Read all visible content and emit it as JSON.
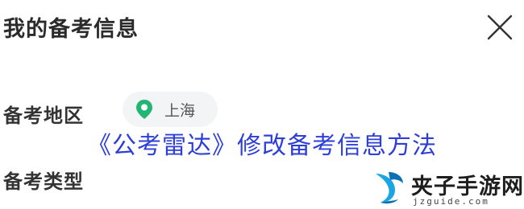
{
  "header": {
    "title": "我的备考信息"
  },
  "icons": {
    "close": "close-icon",
    "pin": "location-pin-icon"
  },
  "form": {
    "region_label": "备考地区",
    "region_value": "上海",
    "type_label": "备考类型"
  },
  "overlay": {
    "title": "《公考雷达》修改备考信息方法"
  },
  "watermark": {
    "name": "夹子手游网",
    "url": "jzguide.com"
  },
  "colors": {
    "accent_green": "#22b573",
    "overlay_blue": "#2d3fd8",
    "chip_bg": "#f3f4f6"
  }
}
